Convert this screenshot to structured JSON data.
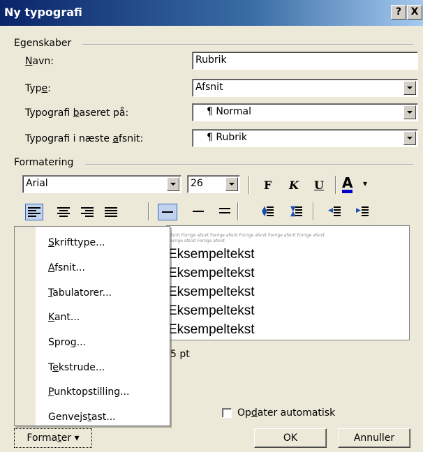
{
  "window": {
    "title": "Ny typografi",
    "help_label": "?",
    "close_label": "X"
  },
  "properties": {
    "group_label": "Egenskaber",
    "name_label_hot": "N",
    "name_label_rest": "avn:",
    "name_value": "Rubrik",
    "type_label_pre": "Typ",
    "type_label_hot": "e",
    "type_label_post": ":",
    "type_value": "Afsnit",
    "based_label_pre": "Typografi ",
    "based_label_hot": "b",
    "based_label_post": "aseret på:",
    "based_value": "¶ Normal",
    "next_label_pre": "Typografi i næste ",
    "next_label_hot": "a",
    "next_label_post": "fsnit:",
    "next_value": "¶ Rubrik"
  },
  "formatting": {
    "group_label": "Formatering",
    "font": "Arial",
    "size": "26",
    "bold": "F",
    "italic": "K",
    "underline": "U",
    "font_color_glyph": "A",
    "dropdown_glyph": "▾"
  },
  "preview": {
    "tiny_line1": "afsnit Forrige afsnit Forrige afsnit Forrige afsnit Forrige afsnit Forrige afsnit",
    "tiny_line2": "Forrige afsnit Forrige afsnit",
    "sample_lines": [
      "Eksempeltekst",
      "Eksempeltekst",
      "Eksempeltekst",
      "Eksempeltekst",
      "Eksempeltekst"
    ],
    "desc_partial": "5 pt"
  },
  "menu": {
    "items": [
      {
        "hot": "S",
        "rest": "krifttype..."
      },
      {
        "hot": "A",
        "rest": "fsnit..."
      },
      {
        "hot": "T",
        "rest": "abulatorer..."
      },
      {
        "hot": "K",
        "rest": "ant..."
      },
      {
        "pre": "Spro",
        "hot": "g",
        "rest": "..."
      },
      {
        "pre": "T",
        "hot": "e",
        "rest": "kstrude..."
      },
      {
        "hot": "P",
        "rest": "unktopstilling..."
      },
      {
        "pre": "Genvejs",
        "hot": "t",
        "rest": "ast..."
      }
    ]
  },
  "footer": {
    "auto_update_pre": "Op",
    "auto_update_hot": "d",
    "auto_update_post": "ater automatisk",
    "format_pre": "Forma",
    "format_hot": "t",
    "format_post": "er",
    "format_arrow": "▾",
    "ok": "OK",
    "cancel": "Annuller"
  }
}
